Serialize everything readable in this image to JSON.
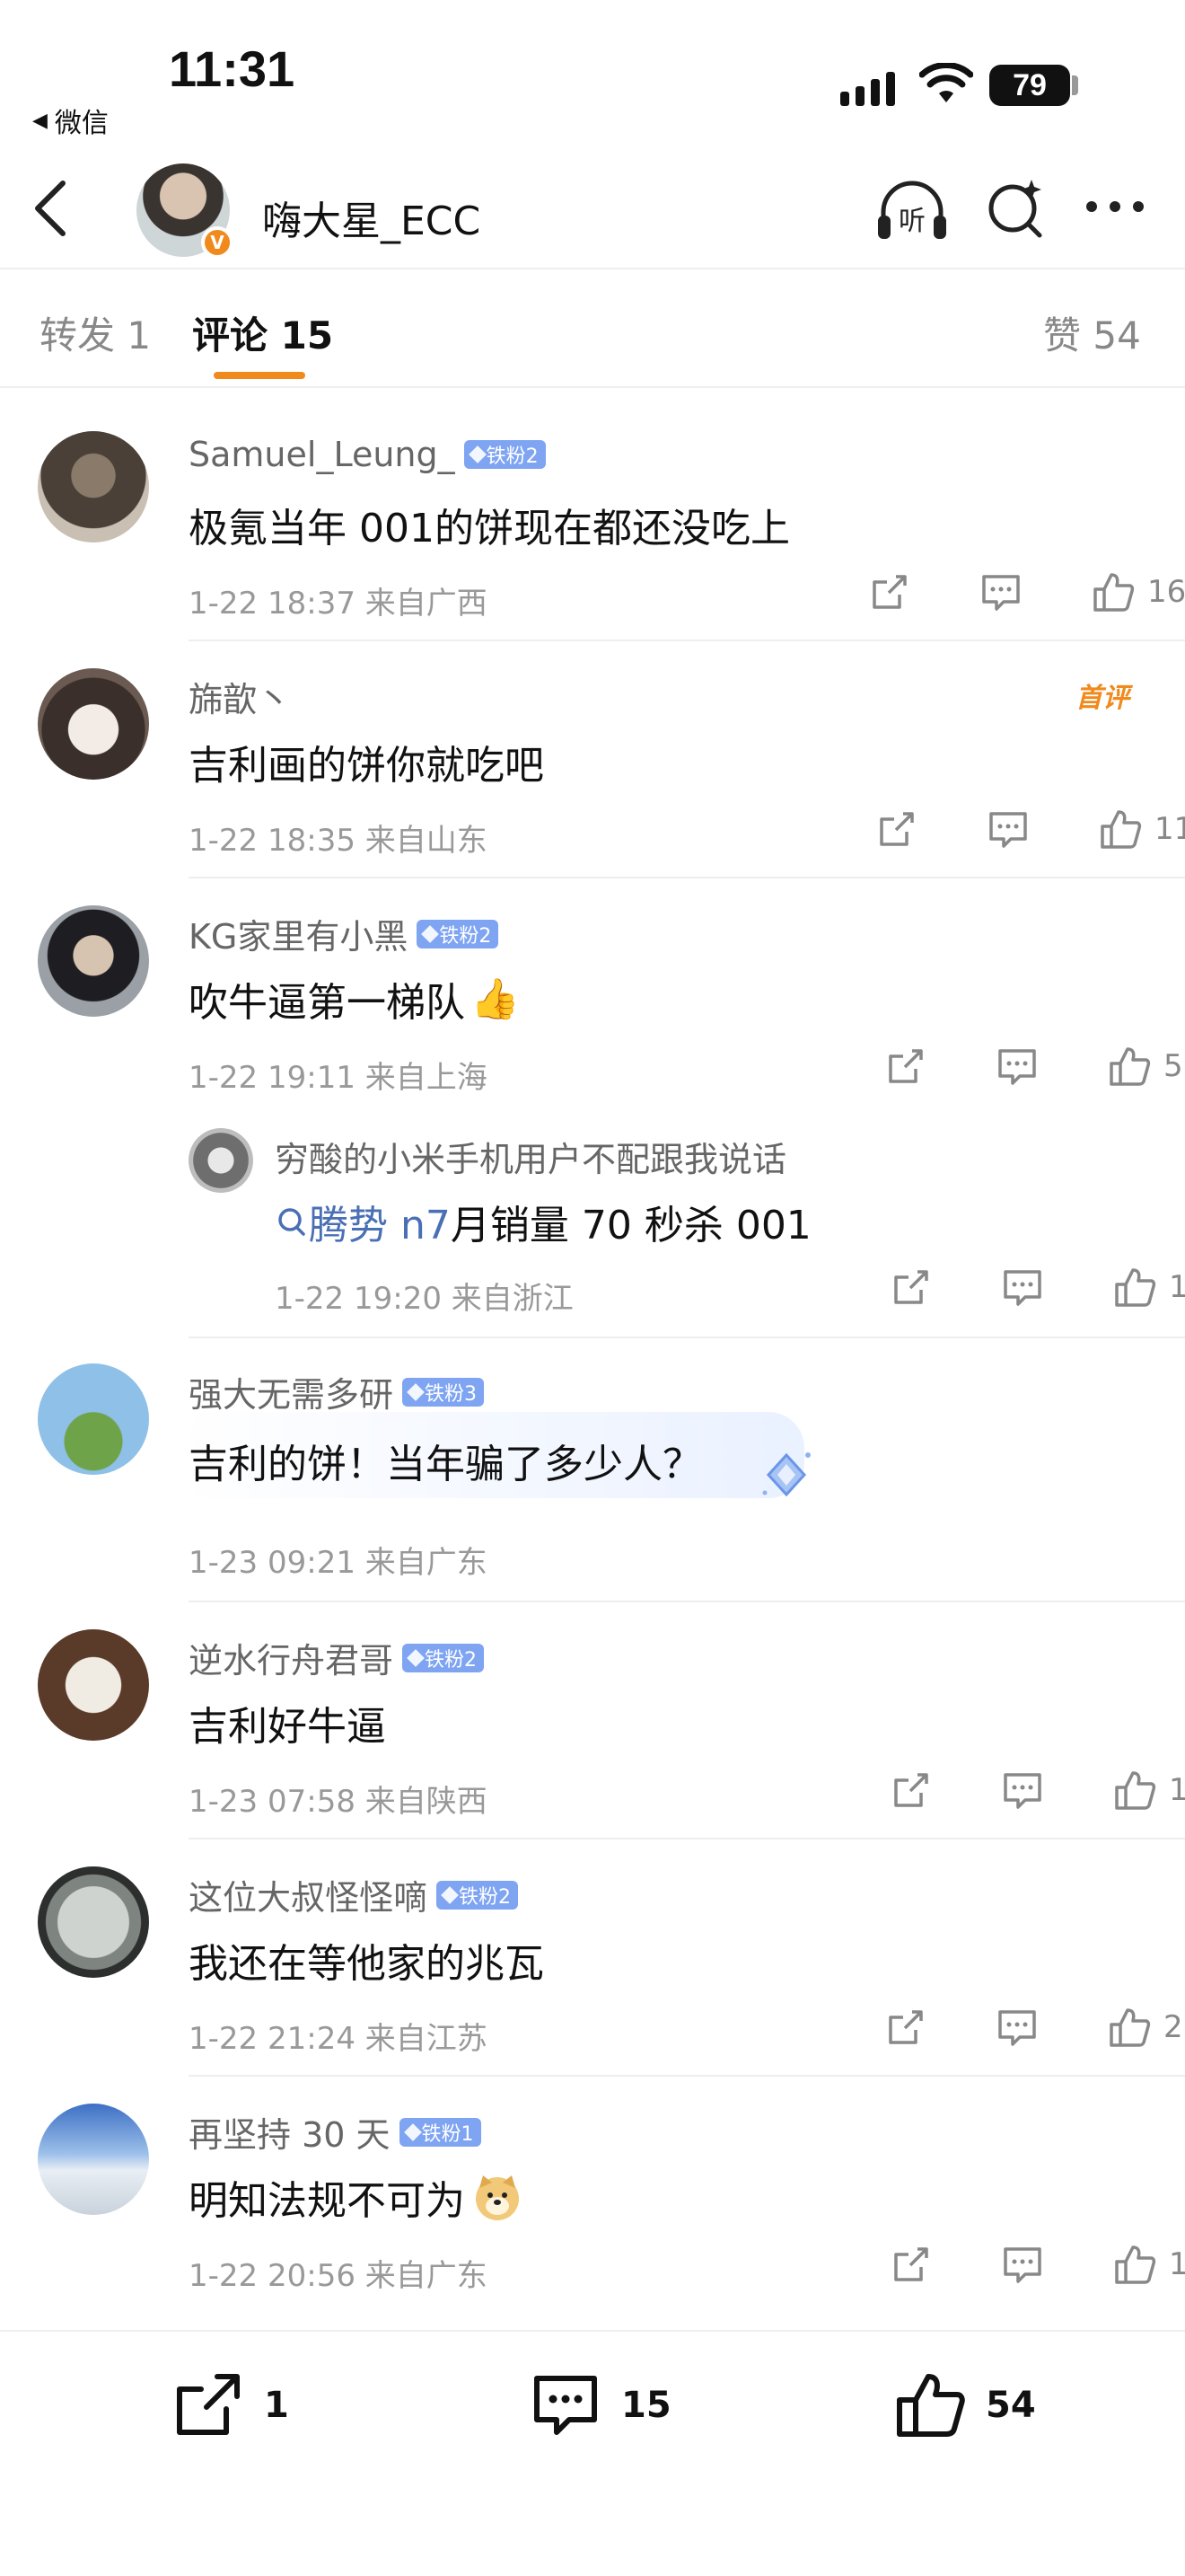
{
  "status_bar": {
    "time": "11:31",
    "back_app": "微信",
    "battery": "79"
  },
  "header": {
    "name": "嗨大星_ECC",
    "verified_mark": "V"
  },
  "tabs": {
    "repost": "转发 1",
    "comments": "评论 15",
    "likes": "赞 54"
  },
  "comments": [
    {
      "user": "Samuel_Leung_",
      "badge": "铁粉2",
      "text": "极氪当年 001的饼现在都还没吃上",
      "time": "1-22 18:37",
      "location": "来自广西",
      "likes": "16"
    },
    {
      "user": "旆歆丶",
      "first_badge": "首评",
      "text": "吉利画的饼你就吃吧",
      "time": "1-22 18:35",
      "location": "来自山东",
      "likes": "11"
    },
    {
      "user": "KG家里有小黑",
      "badge": "铁粉2",
      "text": "吹牛逼第一梯队",
      "time": "1-22 19:11",
      "location": "来自上海",
      "likes": "5",
      "reply": {
        "user": "穷酸的小米手机用户不配跟我说话",
        "link": "腾势 n7",
        "text": "月销量 70 秒杀 001",
        "time": "1-22 19:20",
        "location": "来自浙江",
        "likes": "1"
      }
    },
    {
      "user": "强大无需多研",
      "badge": "铁粉3",
      "text": "吉利的饼！当年骗了多少人？",
      "time": "1-23 09:21",
      "location": "来自广东"
    },
    {
      "user": "逆水行舟君哥",
      "badge": "铁粉2",
      "text": "吉利好牛逼",
      "time": "1-23 07:58",
      "location": "来自陕西",
      "likes": "1"
    },
    {
      "user": "这位大叔怪怪嘀",
      "badge": "铁粉2",
      "text": "我还在等他家的兆瓦",
      "time": "1-22 21:24",
      "location": "来自江苏",
      "likes": "2"
    },
    {
      "user": "再坚持 30 天",
      "badge": "铁粉1",
      "text": "明知法规不可为",
      "time": "1-22 20:56",
      "location": "来自广东",
      "likes": "1"
    }
  ],
  "bottom_bar": {
    "reposts": "1",
    "comments": "15",
    "likes": "54"
  },
  "colors": {
    "accent": "#f08a1c",
    "badge": "#7ea4f2",
    "link": "#4a6fb5"
  }
}
